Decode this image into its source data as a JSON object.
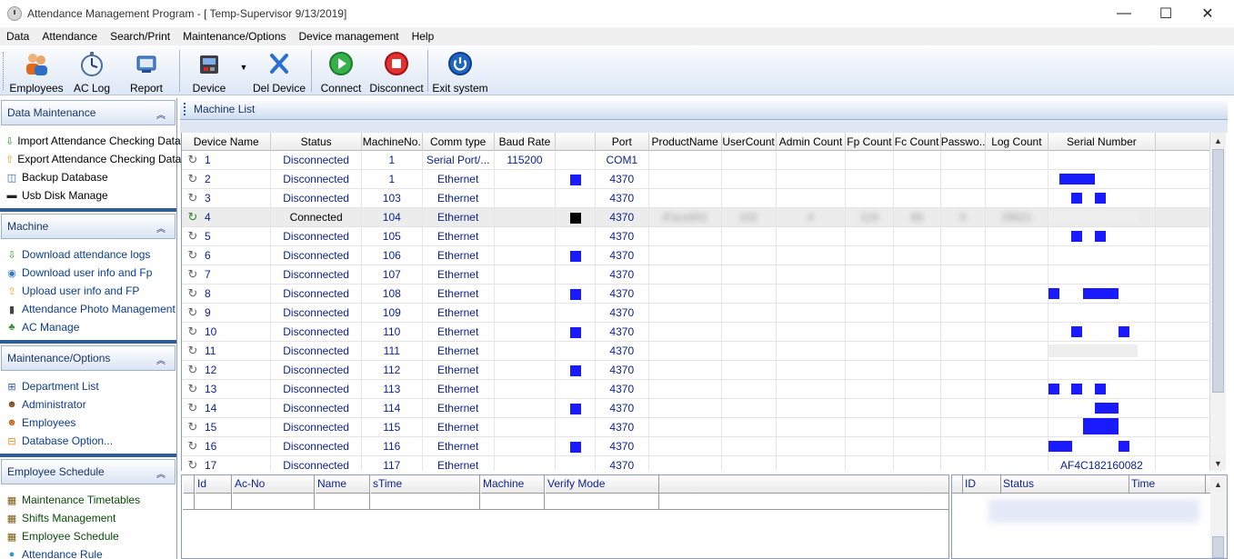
{
  "window": {
    "title": "Attendance Management Program - [ Temp-Supervisor 9/13/2019]",
    "minimize": "—",
    "maximize": "☐",
    "close": "✕"
  },
  "menu": [
    "Data",
    "Attendance",
    "Search/Print",
    "Maintenance/Options",
    "Device management",
    "Help"
  ],
  "toolbar": {
    "employees": "Employees",
    "ac_log": "AC Log",
    "report": "Report",
    "device": "Device",
    "del_device": "Del Device",
    "connect": "Connect",
    "disconnect": "Disconnect",
    "exit": "Exit system"
  },
  "sidebar": {
    "data_maintenance": {
      "title": "Data Maintenance",
      "items": [
        "Import Attendance Checking Data",
        "Export Attendance Checking Data",
        "Backup Database",
        "Usb Disk Manage"
      ]
    },
    "machine": {
      "title": "Machine",
      "items": [
        "Download attendance logs",
        "Download user info and Fp",
        "Upload user info and FP",
        "Attendance Photo Management",
        "AC Manage"
      ]
    },
    "maintenance": {
      "title": "Maintenance/Options",
      "items": [
        "Department List",
        "Administrator",
        "Employees",
        "Database Option..."
      ]
    },
    "schedule": {
      "title": "Employee Schedule",
      "items": [
        "Maintenance Timetables",
        "Shifts Management",
        "Employee Schedule",
        "Attendance Rule"
      ]
    }
  },
  "machine_list": {
    "title": "Machine List",
    "columns": [
      "Device Name",
      "Status",
      "MachineNo.",
      "Comm type",
      "Baud Rate",
      "",
      "Port",
      "ProductName",
      "UserCount",
      "Admin Count",
      "Fp Count",
      "Fc Count",
      "Passwo...",
      "Log Count",
      "Serial Number"
    ],
    "rows": [
      {
        "name": "1",
        "status": "Disconnected",
        "no": "1",
        "comm": "Serial Port/...",
        "baud": "115200",
        "marker": "none",
        "port": "COM1",
        "serial": ""
      },
      {
        "name": "2",
        "status": "Disconnected",
        "no": "1",
        "comm": "Ethernet",
        "baud": "",
        "marker": "blue",
        "port": "4370",
        "serial": ""
      },
      {
        "name": "3",
        "status": "Disconnected",
        "no": "103",
        "comm": "Ethernet",
        "baud": "",
        "marker": "none",
        "port": "4370",
        "serial": ""
      },
      {
        "name": "4",
        "status": "Connected",
        "no": "104",
        "comm": "Ethernet",
        "baud": "",
        "marker": "black",
        "port": "4370",
        "serial": "",
        "product": "iFace802",
        "user_count": "102",
        "admin_count": "4",
        "fp_count": "124",
        "fc_count": "88",
        "password": "0",
        "log_count": "28621"
      },
      {
        "name": "5",
        "status": "Disconnected",
        "no": "105",
        "comm": "Ethernet",
        "baud": "",
        "marker": "none",
        "port": "4370",
        "serial": ""
      },
      {
        "name": "6",
        "status": "Disconnected",
        "no": "106",
        "comm": "Ethernet",
        "baud": "",
        "marker": "blue",
        "port": "4370",
        "serial": ""
      },
      {
        "name": "7",
        "status": "Disconnected",
        "no": "107",
        "comm": "Ethernet",
        "baud": "",
        "marker": "none",
        "port": "4370",
        "serial": ""
      },
      {
        "name": "8",
        "status": "Disconnected",
        "no": "108",
        "comm": "Ethernet",
        "baud": "",
        "marker": "blue",
        "port": "4370",
        "serial": ""
      },
      {
        "name": "9",
        "status": "Disconnected",
        "no": "109",
        "comm": "Ethernet",
        "baud": "",
        "marker": "none",
        "port": "4370",
        "serial": ""
      },
      {
        "name": "10",
        "status": "Disconnected",
        "no": "110",
        "comm": "Ethernet",
        "baud": "",
        "marker": "blue",
        "port": "4370",
        "serial": ""
      },
      {
        "name": "11",
        "status": "Disconnected",
        "no": "111",
        "comm": "Ethernet",
        "baud": "",
        "marker": "none",
        "port": "4370",
        "serial": ""
      },
      {
        "name": "12",
        "status": "Disconnected",
        "no": "112",
        "comm": "Ethernet",
        "baud": "",
        "marker": "blue",
        "port": "4370",
        "serial": ""
      },
      {
        "name": "13",
        "status": "Disconnected",
        "no": "113",
        "comm": "Ethernet",
        "baud": "",
        "marker": "none",
        "port": "4370",
        "serial": ""
      },
      {
        "name": "14",
        "status": "Disconnected",
        "no": "114",
        "comm": "Ethernet",
        "baud": "",
        "marker": "blue",
        "port": "4370",
        "serial": ""
      },
      {
        "name": "15",
        "status": "Disconnected",
        "no": "115",
        "comm": "Ethernet",
        "baud": "",
        "marker": "none",
        "port": "4370",
        "serial": ""
      },
      {
        "name": "16",
        "status": "Disconnected",
        "no": "116",
        "comm": "Ethernet",
        "baud": "",
        "marker": "blue",
        "port": "4370",
        "serial": ""
      },
      {
        "name": "17",
        "status": "Disconnected",
        "no": "117",
        "comm": "Ethernet",
        "baud": "",
        "marker": "none",
        "port": "4370",
        "serial": "AF4C182160082"
      }
    ]
  },
  "log_grid": {
    "columns": [
      "Id",
      "Ac-No",
      "Name",
      "sTime",
      "Machine",
      "Verify Mode"
    ]
  },
  "status_grid": {
    "columns": [
      "ID",
      "Status",
      "Time"
    ]
  },
  "colors": {
    "accent": "#2f5d9a",
    "redaction": "#1a1aff",
    "link_text": "#0b1f8c"
  }
}
